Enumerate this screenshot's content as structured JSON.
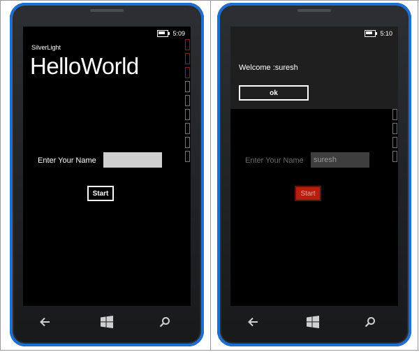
{
  "colors": {
    "phone_accent": "#1f6fd1",
    "screen_bg": "#000000",
    "dialog_bg": "#1f1f1f",
    "input_bg": "#cfcfcf",
    "start_active_red": "#b81d12"
  },
  "phone_left": {
    "status": {
      "time": "5:09",
      "battery_icon": "battery-icon"
    },
    "app_title": "SilverLight",
    "page_title": "HelloWorld",
    "form": {
      "name_label": "Enter Your Name",
      "name_value": "",
      "start_label": "Start"
    },
    "nav": {
      "back": "back-arrow-icon",
      "start": "windows-logo-icon",
      "search": "search-icon"
    }
  },
  "phone_right": {
    "status": {
      "time": "5:10",
      "battery_icon": "battery-icon"
    },
    "dialog": {
      "message": "Welcome :suresh",
      "ok_label": "ok"
    },
    "form": {
      "name_label": "Enter Your Name",
      "name_value": "suresh",
      "start_label": "Start"
    },
    "nav": {
      "back": "back-arrow-icon",
      "start": "windows-logo-icon",
      "search": "search-icon"
    }
  }
}
